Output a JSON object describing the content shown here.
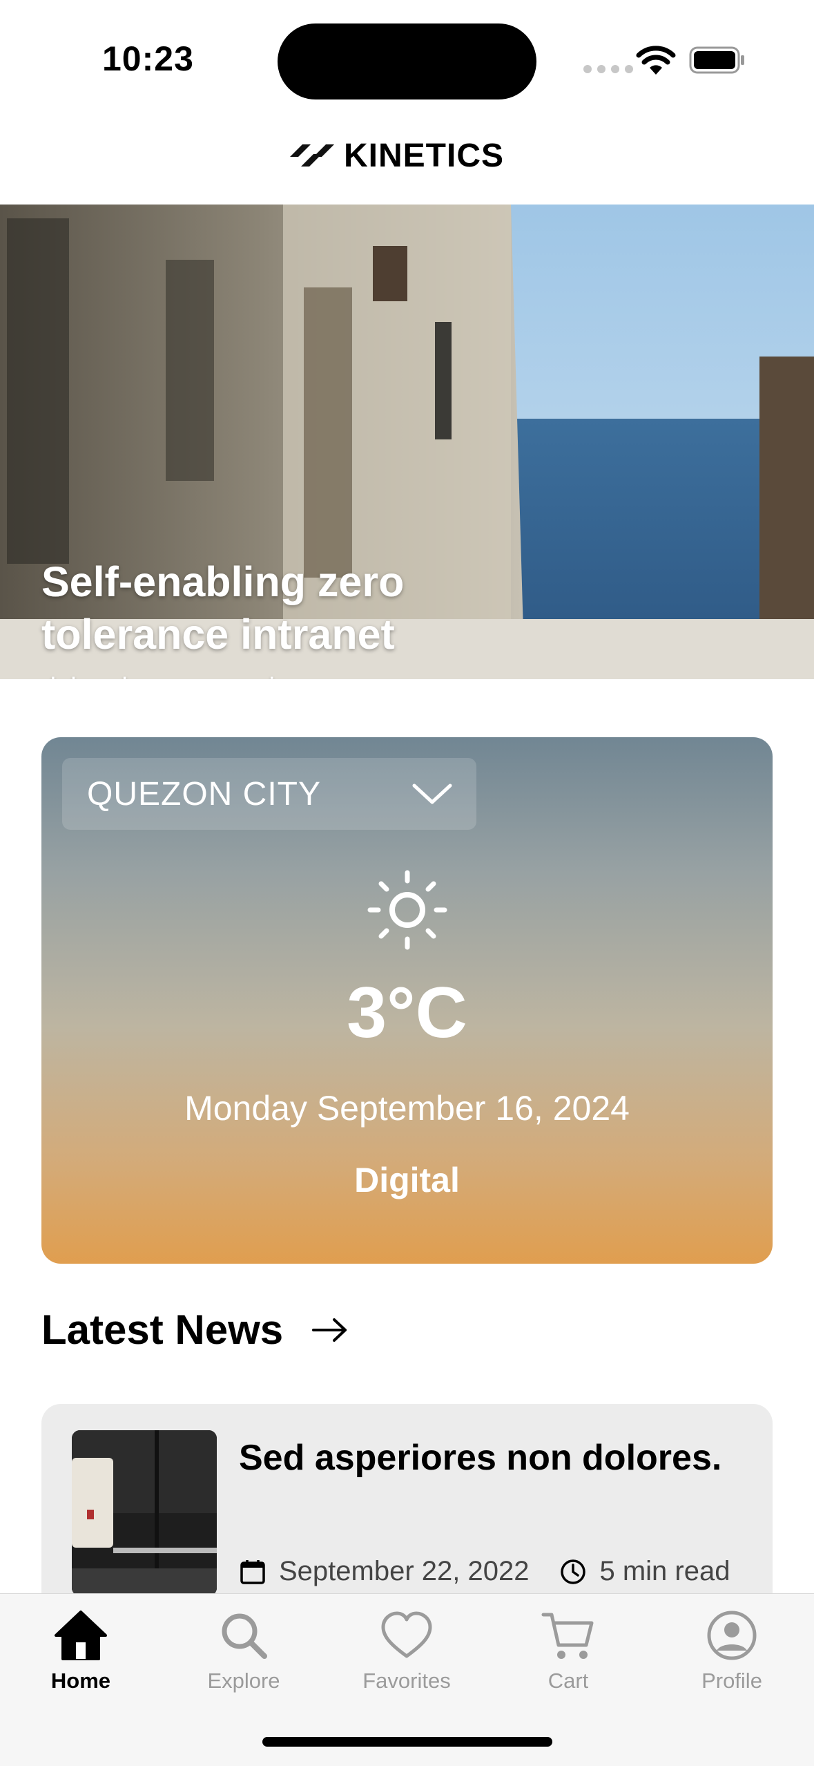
{
  "status_bar": {
    "time": "10:23"
  },
  "brand": {
    "name": "KINETICS"
  },
  "hero": {
    "title": "Self-enabling zero tolerance intranet",
    "subtitle": "dolore harum asperiores",
    "page_count": 3,
    "active_page_index": 1
  },
  "weather": {
    "city": "QUEZON CITY",
    "icon": "sun-icon",
    "temperature": "3°C",
    "date": "Monday September 16, 2024",
    "condition": "Digital"
  },
  "latest_news": {
    "heading": "Latest News",
    "items": [
      {
        "headline": "Sed asperiores non dolores.",
        "date": "September 22, 2022",
        "read_time": "5 min read"
      }
    ]
  },
  "tab_bar": {
    "tabs": [
      {
        "label": "Home",
        "icon": "home-icon",
        "active": true
      },
      {
        "label": "Explore",
        "icon": "search-icon",
        "active": false
      },
      {
        "label": "Favorites",
        "icon": "heart-icon",
        "active": false
      },
      {
        "label": "Cart",
        "icon": "cart-icon",
        "active": false
      },
      {
        "label": "Profile",
        "icon": "profile-icon",
        "active": false
      }
    ]
  },
  "colors": {
    "weather_gradient_top": "#718693",
    "weather_gradient_bottom": "#e09e4f",
    "tab_active": "#000000",
    "tab_inactive": "#9b9b9b"
  }
}
